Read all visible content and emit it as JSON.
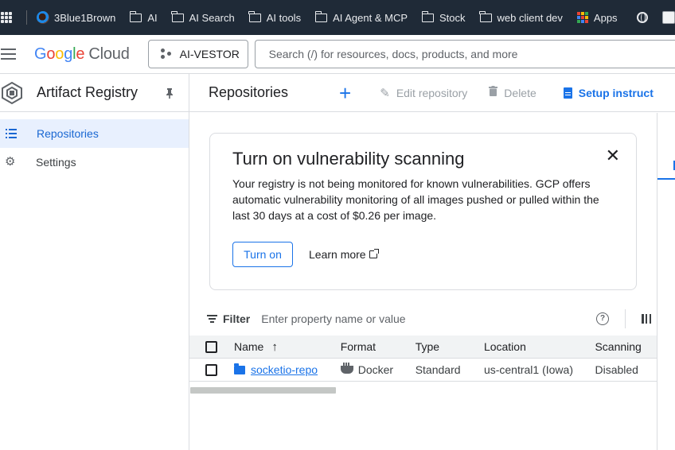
{
  "bookmarks": {
    "items": [
      {
        "label": "3Blue1Brown",
        "icon": "channel-icon"
      },
      {
        "label": "AI",
        "icon": "folder-icon"
      },
      {
        "label": "AI Search",
        "icon": "folder-icon"
      },
      {
        "label": "AI tools",
        "icon": "folder-icon"
      },
      {
        "label": "AI Agent & MCP",
        "icon": "folder-icon"
      },
      {
        "label": "Stock",
        "icon": "folder-icon"
      },
      {
        "label": "web client dev",
        "icon": "folder-icon"
      },
      {
        "label": "Apps",
        "icon": "apps-icon"
      }
    ]
  },
  "header": {
    "logo_parts": [
      "G",
      "o",
      "o",
      "g",
      "l",
      "e"
    ],
    "logo_cloud": "Cloud",
    "project": "AI-VESTOR",
    "search_placeholder": "Search (/) for resources, docs, products, and more"
  },
  "sidebar": {
    "title": "Artifact Registry",
    "items": [
      {
        "label": "Repositories",
        "icon": "list-icon",
        "active": true
      },
      {
        "label": "Settings",
        "icon": "gear-icon",
        "active": false
      }
    ]
  },
  "main": {
    "title": "Repositories",
    "actions": {
      "create_icon": "+",
      "edit": "Edit repository",
      "delete": "Delete",
      "setup": "Setup instruct"
    },
    "banner": {
      "title": "Turn on vulnerability scanning",
      "body": "Your registry is not being monitored for known vulnerabilities. GCP offers automatic vulnerability monitoring of all images pushed or pulled within the last 30 days at a cost of $0.26 per image.",
      "primary": "Turn on",
      "secondary": "Learn more"
    },
    "filter": {
      "label": "Filter",
      "placeholder": "Enter property name or value"
    },
    "table": {
      "columns": [
        "Name",
        "Format",
        "Type",
        "Location",
        "Scanning"
      ],
      "rows": [
        {
          "name": "socketio-repo",
          "format": "Docker",
          "type": "Standard",
          "location": "us-central1 (Iowa)",
          "scanning": "Disabled"
        }
      ]
    }
  },
  "colors": {
    "accent": "#1a73e8",
    "bookmarks_bg": "#1f2a37",
    "active_nav_bg": "#e8f0fe"
  }
}
